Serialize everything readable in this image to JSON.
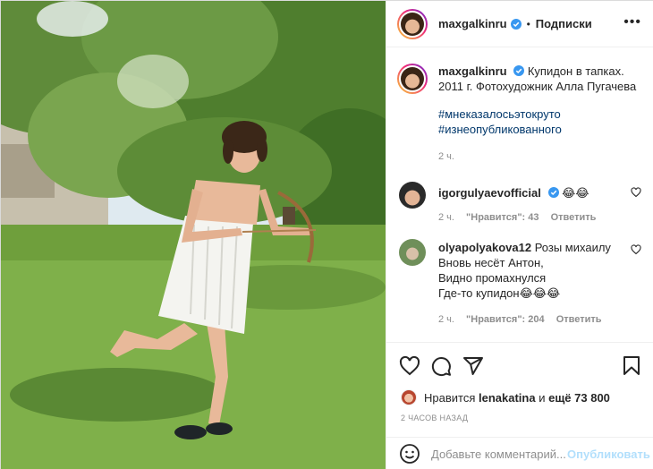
{
  "post": {
    "username": "maxgalkinru",
    "dot": "•",
    "follow_label": "Подписки",
    "more": "•••"
  },
  "caption": {
    "username": "maxgalkinru",
    "text": "Купидон в тапках. 2011 г. Фотохудожник Алла Пугачева",
    "hashtags": [
      "#мнеказалосьэтокруто",
      "#изнеопубликованного"
    ],
    "time": "2 ч."
  },
  "comments": [
    {
      "username": "igorgulyaevofficial",
      "text": "😂😂",
      "time": "2 ч.",
      "likes": "\"Нравится\": 43",
      "reply": "Ответить"
    },
    {
      "username": "olyapolyakova12",
      "text": "Розы михаилу\nВновь несёт Антон,\nВидно промахнулся\nГде-то купидон😂😂😂",
      "time": "2 ч.",
      "likes": "\"Нравится\": 204",
      "reply": "Ответить"
    }
  ],
  "likes": {
    "prefix": "Нравится",
    "user": "lenakatina",
    "mid": "и",
    "rest": "ещё 73 800"
  },
  "timestamp": "2 ЧАСОВ НАЗАД",
  "comment_box": {
    "placeholder": "Добавьте комментарий...",
    "publish_label": "Опубликовать"
  },
  "icons": {
    "heart": "heart-icon",
    "comment": "comment-icon",
    "share": "share-icon",
    "bookmark": "bookmark-icon",
    "emoji": "emoji-icon",
    "verified": "verified-badge-icon"
  },
  "colors": {
    "link": "#00376b",
    "muted": "#8e8e8e",
    "verified": "#3897f0",
    "publish_disabled": "#b2dffc"
  }
}
